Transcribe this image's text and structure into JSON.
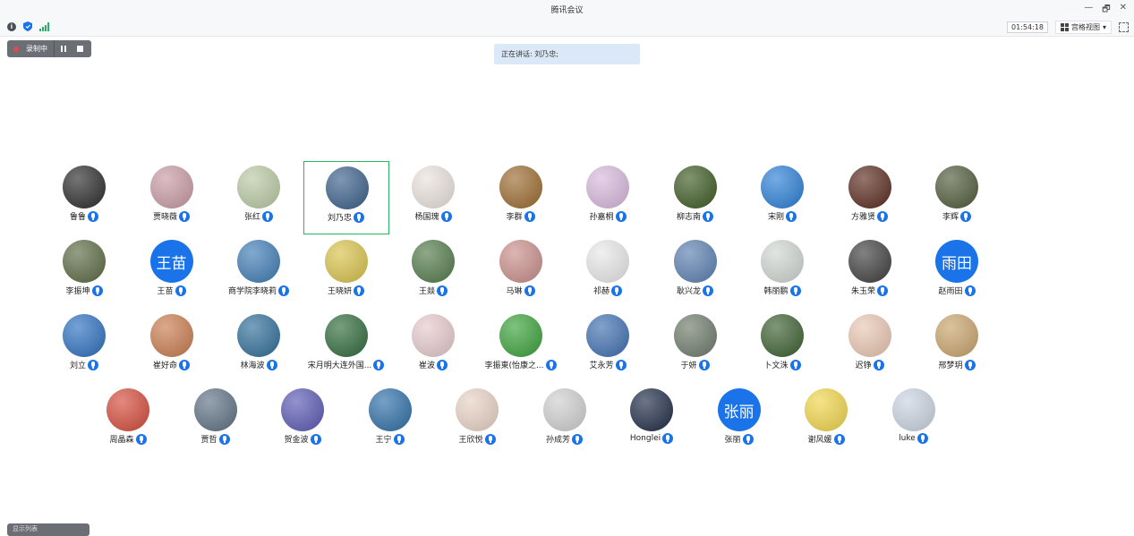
{
  "window": {
    "title": "腾讯会议",
    "controls": [
      "—",
      "🗗",
      "✕"
    ]
  },
  "toolbar": {
    "info_icon": "info-icon",
    "shield_icon": "shield-icon",
    "signal_icon": "signal-icon",
    "timer": "01:54:18",
    "view_label": "宫格视图",
    "view_caret": "▾"
  },
  "recording": {
    "label": "录制中"
  },
  "speaking": {
    "text": "正在讲话: 刘乃忠;"
  },
  "bottom": {
    "label": "显示列表"
  },
  "participants": [
    {
      "name": "鲁鲁",
      "avatar": "dark photo",
      "color": "#2b2b2b"
    },
    {
      "name": "贾晓薇",
      "avatar": "flowers",
      "color": "#c89aa3"
    },
    {
      "name": "张红",
      "avatar": "illustration",
      "color": "#b9c9a3"
    },
    {
      "name": "刘乃忠",
      "avatar": "tree",
      "color": "#3a5f8a",
      "active": true
    },
    {
      "name": "杨国瑰",
      "avatar": "cartoon girl",
      "color": "#e9e2dc"
    },
    {
      "name": "李群",
      "avatar": "bear",
      "color": "#9c6a2f"
    },
    {
      "name": "孙嘉桐",
      "avatar": "pink sky",
      "color": "#d7b8dc"
    },
    {
      "name": "柳志南",
      "avatar": "forest",
      "color": "#3c5a22"
    },
    {
      "name": "宋刚",
      "avatar": "slide",
      "color": "#2a7ed6"
    },
    {
      "name": "方雅贤",
      "avatar": "heart",
      "color": "#5a2a1f"
    },
    {
      "name": "李辉",
      "avatar": "waterfall",
      "color": "#4f5a3a"
    },
    {
      "name": "李振坤",
      "avatar": "nature",
      "color": "#5b6a43"
    },
    {
      "name": "王苗",
      "avatar_text": "王苗",
      "color": "#1a73e8"
    },
    {
      "name": "商学院李晓莉",
      "avatar": "sea",
      "color": "#3f7cb5"
    },
    {
      "name": "王晓妍",
      "avatar": "cartoon",
      "color": "#d8c24b"
    },
    {
      "name": "王燚",
      "avatar": "lake",
      "color": "#527a4a"
    },
    {
      "name": "马琳",
      "avatar": "girl",
      "color": "#c98e8a"
    },
    {
      "name": "祁赫",
      "avatar": "default",
      "color": "#e8e8e8"
    },
    {
      "name": "耿兴龙",
      "avatar": "sky",
      "color": "#5b7fb0"
    },
    {
      "name": "韩丽鹏",
      "avatar": "dancer",
      "color": "#cfd6d2"
    },
    {
      "name": "朱玉荣",
      "avatar": "fashion",
      "color": "#3e3e3e"
    },
    {
      "name": "赵雨田",
      "avatar_text": "雨田",
      "color": "#1a73e8"
    },
    {
      "name": "刘立",
      "avatar": "man",
      "color": "#2c6fbf"
    },
    {
      "name": "崔好命",
      "avatar": "cartoon",
      "color": "#c97b4e"
    },
    {
      "name": "林海波",
      "avatar": "jetski",
      "color": "#2f6d98"
    },
    {
      "name": "宋月明大连外国...",
      "avatar": "river",
      "color": "#2f6a3a"
    },
    {
      "name": "崔波",
      "avatar": "lotus",
      "color": "#e6c9cc"
    },
    {
      "name": "李振東(怡康之...",
      "avatar": "tree logo",
      "color": "#3aa13a"
    },
    {
      "name": "艾永芳",
      "avatar": "sky",
      "color": "#3f6fb0"
    },
    {
      "name": "于妍",
      "avatar": "park",
      "color": "#6e7a6a"
    },
    {
      "name": "卜文洙",
      "avatar": "footballer",
      "color": "#3b5f2f"
    },
    {
      "name": "迟铮",
      "avatar": "cartoon boy",
      "color": "#e9c6b2"
    },
    {
      "name": "邢梦玥",
      "avatar": "lion",
      "color": "#c9a36b"
    },
    {
      "name": "周晶森",
      "avatar": "opera",
      "color": "#d44a3a"
    },
    {
      "name": "贾哲",
      "avatar": "winter tree",
      "color": "#5e7184"
    },
    {
      "name": "贺金波",
      "avatar": "lavender",
      "color": "#5a58b4"
    },
    {
      "name": "王宁",
      "avatar": "mountain",
      "color": "#2d6ea6"
    },
    {
      "name": "王欣悦",
      "avatar": "girl",
      "color": "#e8d2c4"
    },
    {
      "name": "孙成芳",
      "avatar": "boy",
      "color": "#cfcfcf"
    },
    {
      "name": "Honglei",
      "avatar": "sunset",
      "color": "#1f2b46"
    },
    {
      "name": "张丽",
      "avatar_text": "张丽",
      "color": "#1a73e8"
    },
    {
      "name": "谢风媛",
      "avatar": "smiley flower",
      "color": "#f0d54a"
    },
    {
      "name": "luke",
      "avatar": "panda",
      "color": "#c9d3e0"
    }
  ]
}
